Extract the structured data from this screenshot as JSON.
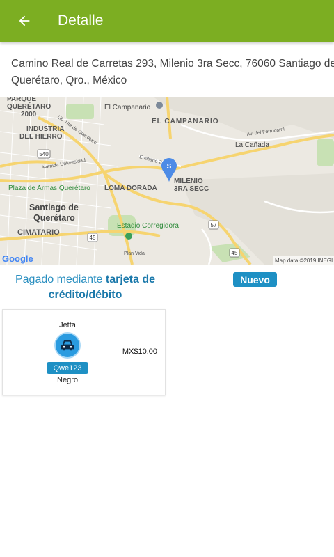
{
  "appbar": {
    "title": "Detalle",
    "back_icon": "arrow-back-icon"
  },
  "address": {
    "line1": "Camino Real de Carretas 293, Milenio 3ra Secc, 76060 Santiago de",
    "line2": "Querétaro, Qro., México"
  },
  "map": {
    "labels": {
      "parque_queretaro_1": "PARQUE",
      "parque_queretaro_2": "QUERÉTARO",
      "parque_queretaro_3": "2000",
      "el_campanario_poi": "El Campanario",
      "el_campanario": "EL CAMPANARIO",
      "industria_1": "INDUSTRIA",
      "industria_2": "DEL HIERRO",
      "lib_norte": "Lib. Nte de Querétaro",
      "av_ferrocarril": "Av. del Ferrocarril",
      "la_canada": "La Cañada",
      "emiliano": "Emiliano Zapata",
      "avenida_univ": "Avenida Universidad",
      "plaza_armas": "Plaza de Armas Querétaro",
      "loma_dorada": "LOMA DORADA",
      "milenio_1": "MILENIO",
      "milenio_2": "3RA SECC",
      "santiago_1": "Santiago de",
      "santiago_2": "Querétaro",
      "cimatario": "CIMATARIO",
      "estadio": "Estadio Corregidora",
      "plan_vida": "Plan Vida",
      "road_540": "540",
      "road_45_a": "45",
      "road_45_b": "45",
      "road_57": "57",
      "pin_letter": "S",
      "google": "Google",
      "attribution": "Map data ©2019 INEGI"
    },
    "pin_color": "#4d8be6",
    "park_color": "#c8e1b4",
    "road_color": "#f6d470"
  },
  "payment": {
    "prefix": "Pagado mediante",
    "method_line1": "tarjeta de",
    "method_line2": "crédito/débito"
  },
  "status": {
    "label": "Nuevo"
  },
  "vehicle": {
    "model": "Jetta",
    "icon": "car-icon",
    "plate": "Qwe123",
    "color": "Negro",
    "price": "MX$10.00"
  }
}
